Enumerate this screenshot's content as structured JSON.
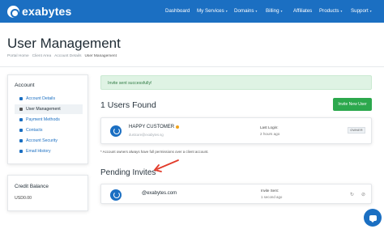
{
  "brand": {
    "name": "exabytes",
    "color": "#1b6fc2"
  },
  "nav": {
    "items": [
      {
        "label": "Dashboard",
        "has_menu": false
      },
      {
        "label": "My Services",
        "has_menu": true
      },
      {
        "label": "Domains",
        "has_menu": true
      },
      {
        "label": "Billing",
        "has_menu": true
      },
      {
        "label": "Affiliates",
        "has_menu": false
      },
      {
        "label": "Products",
        "has_menu": true
      },
      {
        "label": "Support",
        "has_menu": true
      }
    ],
    "chevron": "▾"
  },
  "page": {
    "title": "User Management",
    "breadcrumb": [
      "Portal Home",
      "Client Area",
      "Account Details",
      "User Management"
    ]
  },
  "sidebar": {
    "account_heading": "Account",
    "items": [
      {
        "label": "Account Details",
        "icon": "user-icon",
        "active": false
      },
      {
        "label": "User Management",
        "icon": "users-icon",
        "active": true
      },
      {
        "label": "Payment Methods",
        "icon": "credit-card-icon",
        "active": false
      },
      {
        "label": "Contacts",
        "icon": "contacts-icon",
        "active": false
      },
      {
        "label": "Account Security",
        "icon": "lock-icon",
        "active": false
      },
      {
        "label": "Email History",
        "icon": "envelope-icon",
        "active": false
      }
    ],
    "credit": {
      "heading": "Credit Balance",
      "value": "USD0.00"
    }
  },
  "main": {
    "alert": "Invite sent successfully!",
    "users_count": "1 Users Found",
    "invite_button": "Invite New User",
    "user": {
      "name": "HAPPY CUSTOMER",
      "email": "dustcare@exabytes.sg",
      "last_login_label": "Last Login:",
      "last_login_value": "2 hours ago",
      "badge": "OWNER"
    },
    "note": "* Account owners always have full permissions over a client account.",
    "pending_title": "Pending Invites",
    "invite": {
      "email": "@exabytes.com",
      "sent_label": "Invite Sent:",
      "sent_value": "1 second ago"
    }
  },
  "colors": {
    "accent": "#1b6fc2",
    "success": "#2ca84d",
    "alert_bg": "#dff3e4",
    "annotation_arrow": "#e23b2a",
    "status_dot": "#f0a21a"
  }
}
